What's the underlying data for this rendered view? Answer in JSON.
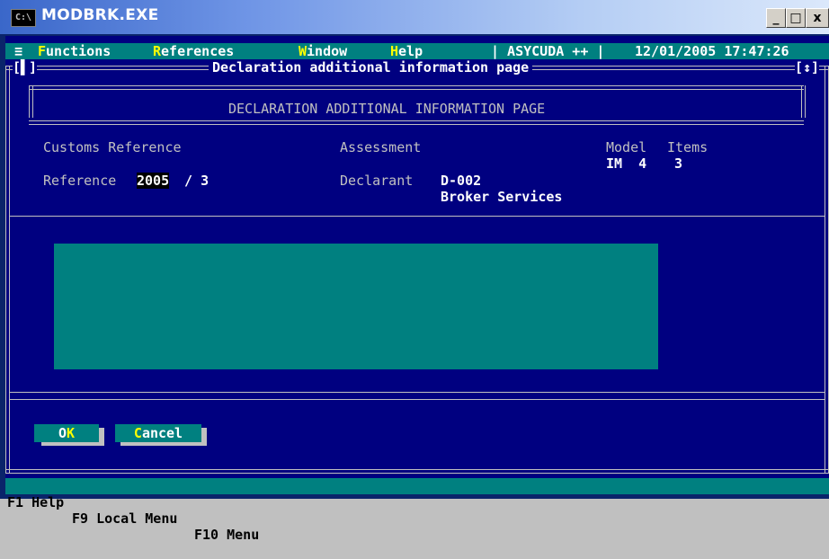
{
  "window": {
    "title": "MODBRK.EXE",
    "icon_text": "C:\\",
    "minimize": "_",
    "maximize": "□",
    "close": "x"
  },
  "menubar": {
    "system": "≡",
    "items": [
      {
        "hot": "F",
        "rest": "unctions"
      },
      {
        "hot": "R",
        "rest": "eferences"
      },
      {
        "hot": "W",
        "rest": "indow"
      },
      {
        "hot": "H",
        "rest": "elp"
      }
    ],
    "app": "| ASYCUDA ++ |",
    "datetime": "12/01/2005 17:47:26"
  },
  "frame": {
    "left_mark": "[▌]",
    "title": "Declaration additional information page",
    "right_mark": "[↕]"
  },
  "page": {
    "heading": "DECLARATION ADDITIONAL INFORMATION PAGE",
    "customs_reference_label": "Customs Reference",
    "assessment_label": "Assessment",
    "model_label": "Model",
    "items_label": "Items",
    "model_value": "IM  4",
    "items_value": "3",
    "reference_label": "Reference",
    "reference_year": "2005",
    "reference_sep": " / 3",
    "declarant_label": "Declarant",
    "declarant_code": "D-002",
    "declarant_name": "Broker Services"
  },
  "buttons": {
    "ok": {
      "rest": "O",
      "hot": "K"
    },
    "cancel": {
      "hot": "C",
      "rest": "ancel"
    }
  },
  "statusbar": [
    {
      "key": "F1",
      "label": "Help"
    },
    {
      "key": "F9",
      "label": "Local Menu"
    },
    {
      "key": "F10",
      "label": "Menu"
    }
  ]
}
